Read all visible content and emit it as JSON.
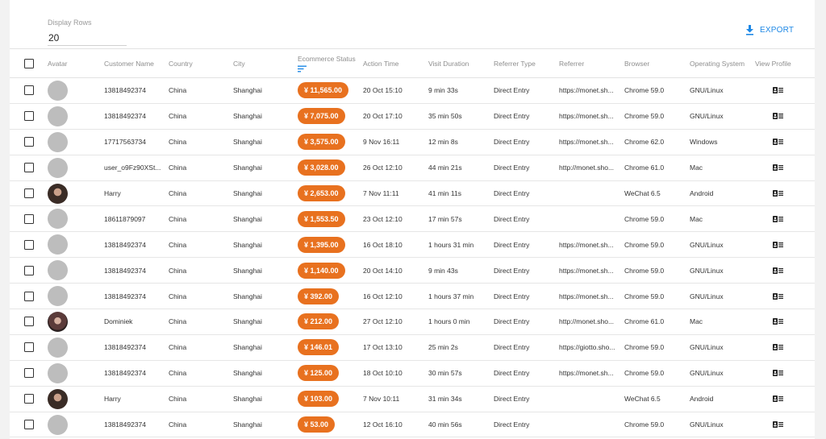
{
  "display_rows": {
    "label": "Display Rows",
    "value": "20"
  },
  "export": {
    "label": "EXPORT",
    "icon": "download-icon",
    "color": "#1e88e5"
  },
  "status_color": "#e8711f",
  "columns": {
    "avatar": "Avatar",
    "customer_name": "Customer Name",
    "country": "Country",
    "city": "City",
    "ecommerce_status": "Ecommerce Status",
    "action_time": "Action Time",
    "visit_duration": "Visit Duration",
    "referrer_type": "Referrer Type",
    "referrer": "Referrer",
    "browser": "Browser",
    "operating_system": "Operating System",
    "view_profile": "View Profile"
  },
  "rows": [
    {
      "avatar": "default",
      "name": "13818492374",
      "country": "China",
      "city": "Shanghai",
      "status": "¥ 11,565.00",
      "time": "20 Oct 15:10",
      "duration": "9 min 33s",
      "ref_type": "Direct Entry",
      "ref": "https://monet.sh...",
      "browser": "Chrome 59.0",
      "os": "GNU/Linux"
    },
    {
      "avatar": "default",
      "name": "13818492374",
      "country": "China",
      "city": "Shanghai",
      "status": "¥ 7,075.00",
      "time": "20 Oct 17:10",
      "duration": "35 min 50s",
      "ref_type": "Direct Entry",
      "ref": "https://monet.sh...",
      "browser": "Chrome 59.0",
      "os": "GNU/Linux"
    },
    {
      "avatar": "default",
      "name": "17717563734",
      "country": "China",
      "city": "Shanghai",
      "status": "¥ 3,575.00",
      "time": "9 Nov 16:11",
      "duration": "12 min 8s",
      "ref_type": "Direct Entry",
      "ref": "https://monet.sh...",
      "browser": "Chrome 62.0",
      "os": "Windows"
    },
    {
      "avatar": "default",
      "name": "user_o9Fz90XSt...",
      "country": "China",
      "city": "Shanghai",
      "status": "¥ 3,028.00",
      "time": "26 Oct 12:10",
      "duration": "44 min 21s",
      "ref_type": "Direct Entry",
      "ref": "http://monet.sho...",
      "browser": "Chrome 61.0",
      "os": "Mac"
    },
    {
      "avatar": "photo",
      "name": "Harry",
      "country": "China",
      "city": "Shanghai",
      "status": "¥ 2,653.00",
      "time": "7 Nov 11:11",
      "duration": "41 min 11s",
      "ref_type": "Direct Entry",
      "ref": "",
      "browser": "WeChat 6.5",
      "os": "Android"
    },
    {
      "avatar": "default",
      "name": "18611879097",
      "country": "China",
      "city": "Shanghai",
      "status": "¥ 1,553.50",
      "time": "23 Oct 12:10",
      "duration": "17 min 57s",
      "ref_type": "Direct Entry",
      "ref": "",
      "browser": "Chrome 59.0",
      "os": "Mac"
    },
    {
      "avatar": "default",
      "name": "13818492374",
      "country": "China",
      "city": "Shanghai",
      "status": "¥ 1,395.00",
      "time": "16 Oct 18:10",
      "duration": "1 hours 31 min",
      "ref_type": "Direct Entry",
      "ref": "https://monet.sh...",
      "browser": "Chrome 59.0",
      "os": "GNU/Linux"
    },
    {
      "avatar": "default",
      "name": "13818492374",
      "country": "China",
      "city": "Shanghai",
      "status": "¥ 1,140.00",
      "time": "20 Oct 14:10",
      "duration": "9 min 43s",
      "ref_type": "Direct Entry",
      "ref": "https://monet.sh...",
      "browser": "Chrome 59.0",
      "os": "GNU/Linux"
    },
    {
      "avatar": "default",
      "name": "13818492374",
      "country": "China",
      "city": "Shanghai",
      "status": "¥ 392.00",
      "time": "16 Oct 12:10",
      "duration": "1 hours 37 min",
      "ref_type": "Direct Entry",
      "ref": "https://monet.sh...",
      "browser": "Chrome 59.0",
      "os": "GNU/Linux"
    },
    {
      "avatar": "photo2",
      "name": "Dominiek",
      "country": "China",
      "city": "Shanghai",
      "status": "¥ 212.00",
      "time": "27 Oct 12:10",
      "duration": "1 hours 0 min",
      "ref_type": "Direct Entry",
      "ref": "http://monet.sho...",
      "browser": "Chrome 61.0",
      "os": "Mac"
    },
    {
      "avatar": "default",
      "name": "13818492374",
      "country": "China",
      "city": "Shanghai",
      "status": "¥ 146.01",
      "time": "17 Oct 13:10",
      "duration": "25 min 2s",
      "ref_type": "Direct Entry",
      "ref": "https://giotto.sho...",
      "browser": "Chrome 59.0",
      "os": "GNU/Linux"
    },
    {
      "avatar": "default",
      "name": "13818492374",
      "country": "China",
      "city": "Shanghai",
      "status": "¥ 125.00",
      "time": "18 Oct 10:10",
      "duration": "30 min 57s",
      "ref_type": "Direct Entry",
      "ref": "https://monet.sh...",
      "browser": "Chrome 59.0",
      "os": "GNU/Linux"
    },
    {
      "avatar": "photo",
      "name": "Harry",
      "country": "China",
      "city": "Shanghai",
      "status": "¥ 103.00",
      "time": "7 Nov 10:11",
      "duration": "31 min 34s",
      "ref_type": "Direct Entry",
      "ref": "",
      "browser": "WeChat 6.5",
      "os": "Android"
    },
    {
      "avatar": "default",
      "name": "13818492374",
      "country": "China",
      "city": "Shanghai",
      "status": "¥ 53.00",
      "time": "12 Oct 16:10",
      "duration": "40 min 56s",
      "ref_type": "Direct Entry",
      "ref": "",
      "browser": "Chrome 59.0",
      "os": "GNU/Linux"
    }
  ]
}
